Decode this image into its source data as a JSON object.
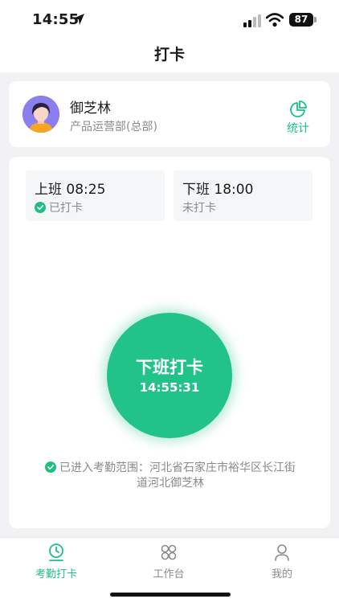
{
  "status_bar": {
    "time": "14:55",
    "battery": "87"
  },
  "header": {
    "title": "打卡"
  },
  "user": {
    "name": "御芝林",
    "department": "产品运营部(总部)",
    "stats_label": "统计"
  },
  "shifts": {
    "on": {
      "label": "上班 08:25",
      "status": "已打卡"
    },
    "off": {
      "label": "下班 18:00",
      "status": "未打卡"
    }
  },
  "punch": {
    "label": "下班打卡",
    "time": "14:55:31"
  },
  "range": {
    "text": "已进入考勤范围：河北省石家庄市裕华区长江街道河北御芝林"
  },
  "tabs": [
    {
      "label": "考勤打卡"
    },
    {
      "label": "工作台"
    },
    {
      "label": "我的"
    }
  ],
  "colors": {
    "accent": "#1dbf82",
    "button": "#22c389"
  }
}
